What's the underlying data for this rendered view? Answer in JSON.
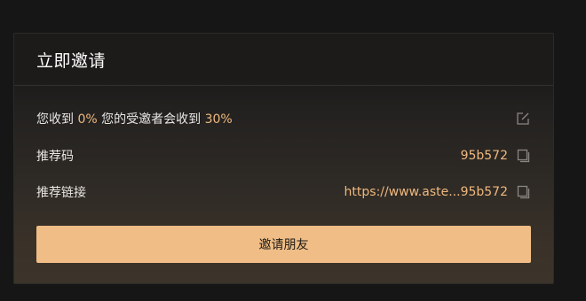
{
  "card": {
    "title": "立即邀请"
  },
  "rebate": {
    "prefix": "您收到",
    "my_rate": "0%",
    "middle": "您的受邀者会收到",
    "friend_rate": "30%"
  },
  "referral_code": {
    "label": "推荐码",
    "value": "95b572"
  },
  "referral_link": {
    "label": "推荐链接",
    "value": "https://www.aste...95b572"
  },
  "actions": {
    "invite_label": "邀请朋友"
  },
  "colors": {
    "accent": "#efb97f",
    "button": "#efbd85",
    "background": "#161616"
  },
  "icons": {
    "edit": "edit-icon",
    "copy": "copy-icon"
  }
}
